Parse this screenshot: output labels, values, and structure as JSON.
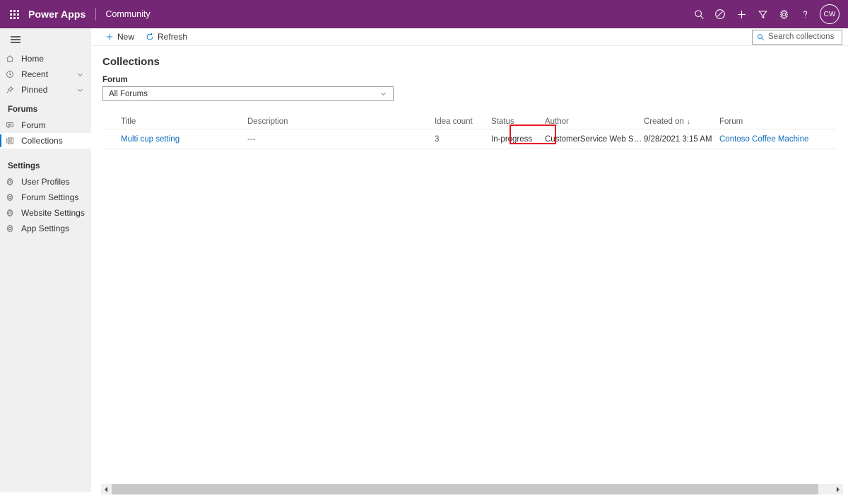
{
  "topbar": {
    "app_launcher_icon": "waffle-grid-icon",
    "brand": "Power Apps",
    "suite_name": "Community",
    "icons": [
      {
        "name": "search-icon",
        "label": "Search"
      },
      {
        "name": "assistant-icon",
        "label": "Assistant"
      },
      {
        "name": "plus-icon",
        "label": "New"
      },
      {
        "name": "filter-icon",
        "label": "Filter"
      },
      {
        "name": "gear-icon",
        "label": "Settings"
      },
      {
        "name": "help-icon",
        "label": "Help"
      }
    ],
    "avatar_initials": "CW",
    "background_color": "#742774"
  },
  "sidebar": {
    "hamburger_icon": "hamburger-icon",
    "items": [
      {
        "label": "Home",
        "icon": "home-icon",
        "expandable": false,
        "selected": false
      },
      {
        "label": "Recent",
        "icon": "clock-icon",
        "expandable": true,
        "selected": false
      },
      {
        "label": "Pinned",
        "icon": "pin-icon",
        "expandable": true,
        "selected": false
      }
    ],
    "groups": [
      {
        "title": "Forums",
        "items": [
          {
            "label": "Forum",
            "icon": "comment-icon",
            "selected": false
          },
          {
            "label": "Collections",
            "icon": "list-icon",
            "selected": true
          }
        ]
      },
      {
        "title": "Settings",
        "items": [
          {
            "label": "User Profiles",
            "icon": "gear-icon",
            "selected": false
          },
          {
            "label": "Forum Settings",
            "icon": "gear-icon",
            "selected": false
          },
          {
            "label": "Website Settings",
            "icon": "gear-icon",
            "selected": false
          },
          {
            "label": "App Settings",
            "icon": "gear-icon",
            "selected": false
          }
        ]
      }
    ],
    "selected_indicator_color": "#0078d4"
  },
  "commandbar": {
    "new_label": "New",
    "new_icon": "plus-icon",
    "refresh_label": "Refresh",
    "refresh_icon": "refresh-icon",
    "search_placeholder": "Search collections",
    "search_value": "",
    "search_icon": "search-icon"
  },
  "page": {
    "title": "Collections",
    "filter_label": "Forum",
    "filter_value": "All Forums",
    "filter_chevron_icon": "chevron-down-icon"
  },
  "grid": {
    "columns": [
      {
        "key": "title",
        "label": "Title"
      },
      {
        "key": "description",
        "label": "Description"
      },
      {
        "key": "idea_count",
        "label": "Idea count"
      },
      {
        "key": "status",
        "label": "Status"
      },
      {
        "key": "author",
        "label": "Author"
      },
      {
        "key": "created_on",
        "label": "Created on",
        "sorted": "desc",
        "sort_glyph": "↓"
      },
      {
        "key": "forum",
        "label": "Forum"
      }
    ],
    "rows": [
      {
        "title": "Multi cup setting",
        "description": "---",
        "idea_count": "3",
        "status": "In-progress",
        "author": "CustomerService Web Staging",
        "created_on": "9/28/2021 3:15 AM",
        "forum": "Contoso Coffee Machine"
      }
    ],
    "link_color": "#0f6cbd"
  },
  "annotation": {
    "highlight_target": "In-progress",
    "highlight_color": "#e81123"
  },
  "scrollbar": {
    "left_arrow_icon": "caret-left-icon",
    "right_arrow_icon": "caret-right-icon",
    "orientation": "horizontal"
  }
}
